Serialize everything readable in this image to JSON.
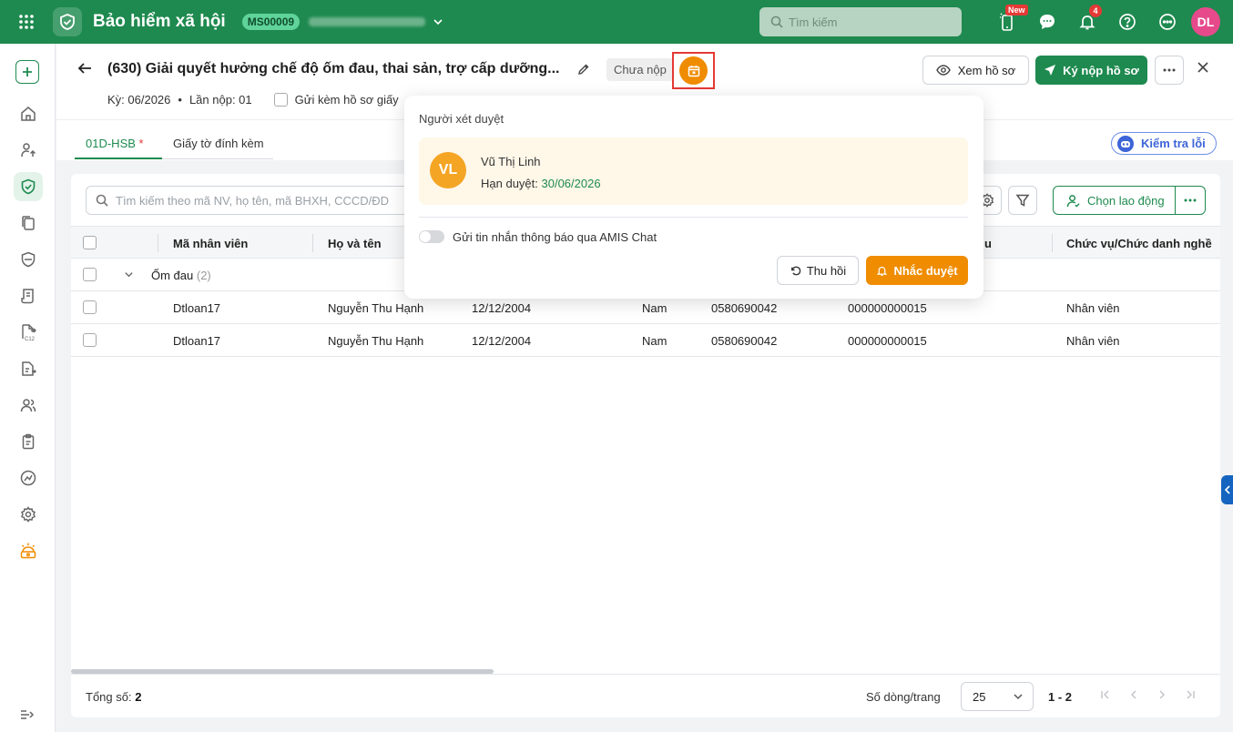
{
  "topbar": {
    "app_title": "Bảo hiểm xã hội",
    "org_code": "MS00009",
    "search_placeholder": "Tìm kiếm",
    "new_badge": "New",
    "notif_count": "4",
    "user_initials": "DL",
    "brand_color": "#1e8a4f"
  },
  "header": {
    "title": "(630) Giải quyết hưởng chế độ ốm đau, thai sản, trợ cấp dưỡng...",
    "status": "Chưa nộp",
    "period": "Kỳ: 06/2026",
    "submit_count": "Lần nộp: 01",
    "attach_label": "Gửi kèm hồ sơ giấy",
    "view_label": "Xem hồ sơ",
    "sign_label": "Ký nộp hồ sơ"
  },
  "tabs": [
    {
      "label": "01D-HSB",
      "required": "*"
    },
    {
      "label": "Giấy tờ đính kèm"
    }
  ],
  "check_errors_label": "Kiểm tra lỗi",
  "table": {
    "search_placeholder": "Tìm kiếm theo mã NV, họ tên, mã BHXH, CCCD/ĐD",
    "choose_label": "Chọn lao động",
    "columns": [
      "Mã nhân viên",
      "Họ và tên",
      "u",
      "Chức vụ/Chức danh nghề"
    ],
    "group": {
      "label": "Ốm đau",
      "count": "(2)"
    },
    "rows": [
      {
        "code": "Dtloan17",
        "name": "Nguyễn Thu Hạnh",
        "dob": "12/12/2004",
        "gender": "Nam",
        "phone": "0580690042",
        "id": "000000000015",
        "position": "Nhân viên"
      },
      {
        "code": "Dtloan17",
        "name": "Nguyễn Thu Hạnh",
        "dob": "12/12/2004",
        "gender": "Nam",
        "phone": "0580690042",
        "id": "000000000015",
        "position": "Nhân viên"
      }
    ],
    "total_label": "Tổng số:",
    "total_value": "2",
    "rows_per_page_label": "Số dòng/trang",
    "rows_per_page": "25",
    "range": "1 - 2"
  },
  "popover": {
    "title": "Người xét duyệt",
    "reviewer_initials": "VL",
    "reviewer_name": "Vũ Thị Linh",
    "due_label": "Hạn duyệt:",
    "due_date": "30/06/2026",
    "notify_label": "Gửi tin nhắn thông báo qua AMIS Chat",
    "notify_enabled": false,
    "recall_label": "Thu hồi",
    "remind_label": "Nhắc duyệt",
    "accent_color": "#f08c00"
  }
}
